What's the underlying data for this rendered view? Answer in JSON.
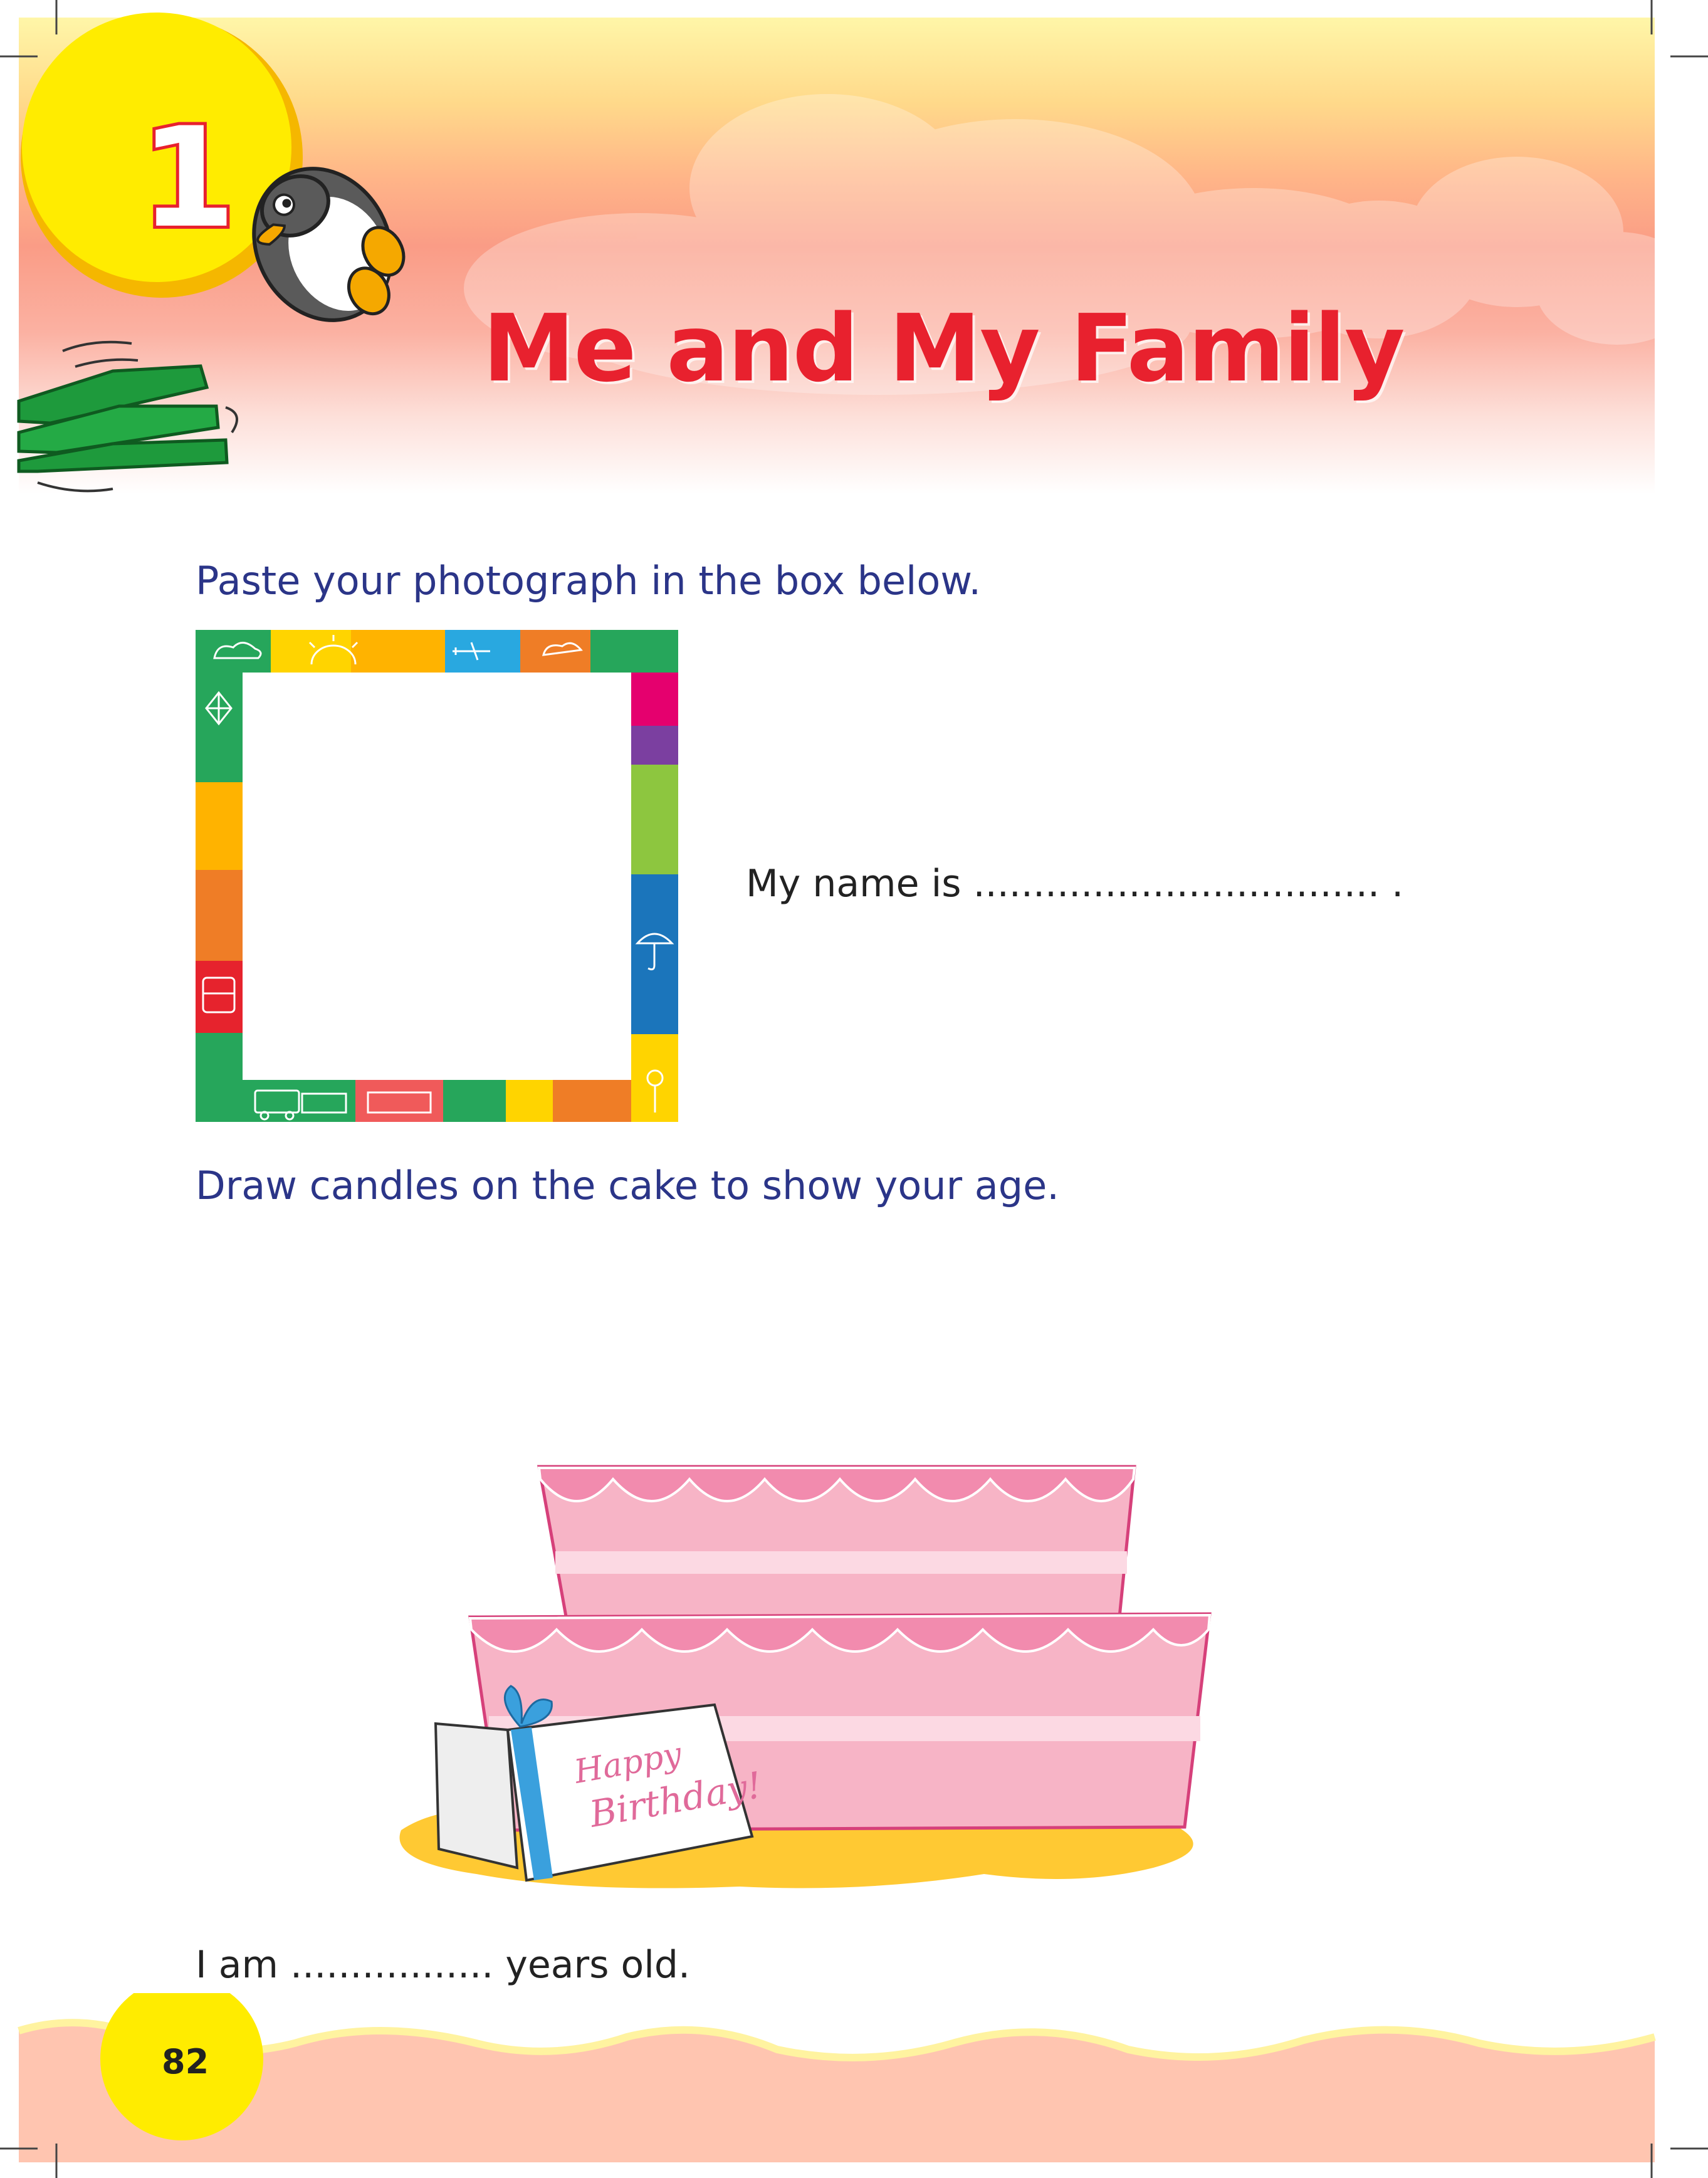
{
  "chapter": {
    "number": "1",
    "title": "Me and My Family"
  },
  "instructions": {
    "photo": "Paste your photograph in the box below.",
    "candles": "Draw candles on the cake to show your age."
  },
  "fill_in": {
    "name": "My name is ..................................  .",
    "age": "I am .................  years old."
  },
  "card": {
    "line1": "Happy",
    "line2": "Birthday!"
  },
  "page_number": "82",
  "colors": {
    "title_red": "#e8212e",
    "instruction_blue": "#2b3588",
    "sun_yellow": "#ffec00",
    "cake_pink": "#f7b4c6"
  },
  "icons": [
    "penguin-icon",
    "books-icon",
    "sun-icon",
    "kite-icon",
    "umbrella-icon",
    "bus-icon",
    "train-icon",
    "airplane-icon"
  ]
}
